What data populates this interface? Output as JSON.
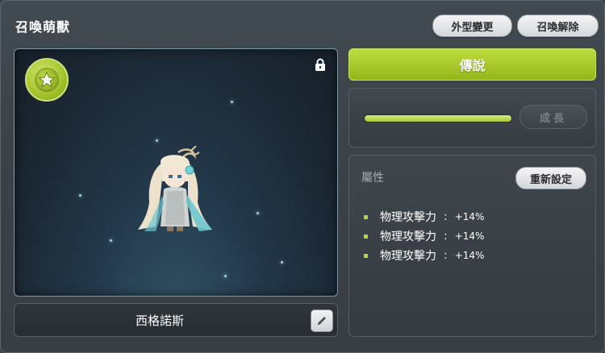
{
  "title": "召喚萌獸",
  "header_buttons": {
    "appearance": "外型變更",
    "release": "召喚解除"
  },
  "pet": {
    "name": "西格諾斯"
  },
  "grade": {
    "label": "傳說",
    "color": "#a9c92b"
  },
  "growth": {
    "progress": 1.0,
    "button": "成長"
  },
  "attributes": {
    "title": "屬性",
    "reset_button": "重新設定",
    "items": [
      {
        "name": "物理攻擊力",
        "sep": ":",
        "value": "+14%"
      },
      {
        "name": "物理攻擊力",
        "sep": ":",
        "value": "+14%"
      },
      {
        "name": "物理攻擊力",
        "sep": ":",
        "value": "+14%"
      }
    ]
  },
  "icons": [
    "star-icon",
    "lock-icon",
    "pencil-icon"
  ]
}
